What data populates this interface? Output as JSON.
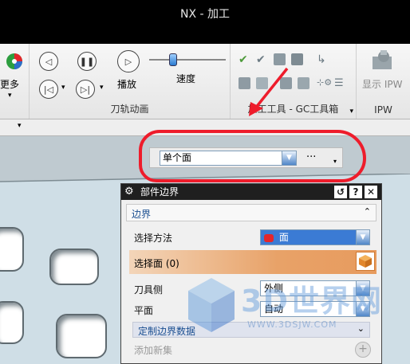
{
  "window": {
    "title": "NX - 加工"
  },
  "ribbon": {
    "more_label": "更多",
    "play_label": "播放",
    "speed_label": "速度",
    "speed_level": 0.3,
    "group_toolpath_anim": "刀轨动画",
    "group_machining_tools": "加工工具 - GC工具箱",
    "show_ipw_label": "显示 IPW",
    "group_ipw": "IPW"
  },
  "selection_bar": {
    "filter_value": "单个面",
    "more_label": "···"
  },
  "dialog": {
    "title": "部件边界",
    "section_label": "边界",
    "select_method_label": "选择方法",
    "select_method_value": "面",
    "select_face_label": "选择面 (0)",
    "tool_side_label": "刀具侧",
    "tool_side_value": "外侧",
    "plane_label": "平面",
    "plane_value": "自动",
    "custom_boundary_label": "定制边界数据",
    "add_new_set_label": "添加新集"
  },
  "watermark": {
    "brand": "3D世界网",
    "url": "WWW.3DSJW.COM"
  },
  "colors": {
    "annotation_red": "#ee1c2b",
    "highlight_orange": "#e8a268",
    "selection_blue": "#3b7bd4"
  }
}
